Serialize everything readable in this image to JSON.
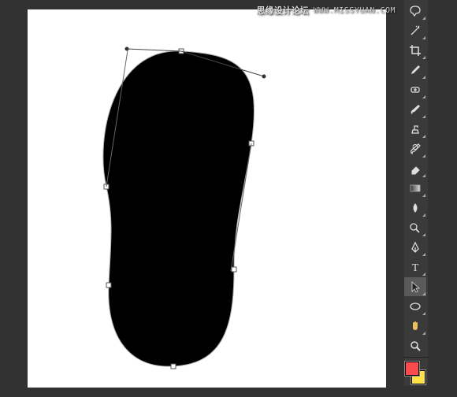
{
  "watermark": {
    "cn": "思缘设计论坛",
    "url": "WWW.MISSYUAN.COM"
  },
  "canvas": {
    "shape_fill": "#000000",
    "background": "#ffffff"
  },
  "colors": {
    "foreground": "#f94b4b",
    "background": "#ffe14a"
  },
  "tools": [
    {
      "name": "lasso-tool",
      "selected": false,
      "flyout": true
    },
    {
      "name": "magic-wand-tool",
      "selected": false,
      "flyout": true
    },
    {
      "name": "crop-tool",
      "selected": false,
      "flyout": true
    },
    {
      "name": "eyedropper-tool",
      "selected": false,
      "flyout": true
    },
    {
      "name": "healing-brush-tool",
      "selected": false,
      "flyout": true
    },
    {
      "name": "brush-tool",
      "selected": false,
      "flyout": true
    },
    {
      "name": "clone-stamp-tool",
      "selected": false,
      "flyout": true
    },
    {
      "name": "history-brush-tool",
      "selected": false,
      "flyout": true
    },
    {
      "name": "eraser-tool",
      "selected": false,
      "flyout": true
    },
    {
      "name": "gradient-tool",
      "selected": false,
      "flyout": true
    },
    {
      "name": "blur-tool",
      "selected": false,
      "flyout": true
    },
    {
      "name": "dodge-tool",
      "selected": false,
      "flyout": true
    },
    {
      "name": "pen-tool",
      "selected": false,
      "flyout": true
    },
    {
      "name": "type-tool",
      "selected": false,
      "flyout": true
    },
    {
      "name": "path-selection-tool",
      "selected": true,
      "flyout": true
    },
    {
      "name": "shape-tool",
      "selected": false,
      "flyout": true
    },
    {
      "name": "hand-tool",
      "selected": false,
      "flyout": true
    },
    {
      "name": "zoom-tool",
      "selected": false,
      "flyout": false
    }
  ]
}
